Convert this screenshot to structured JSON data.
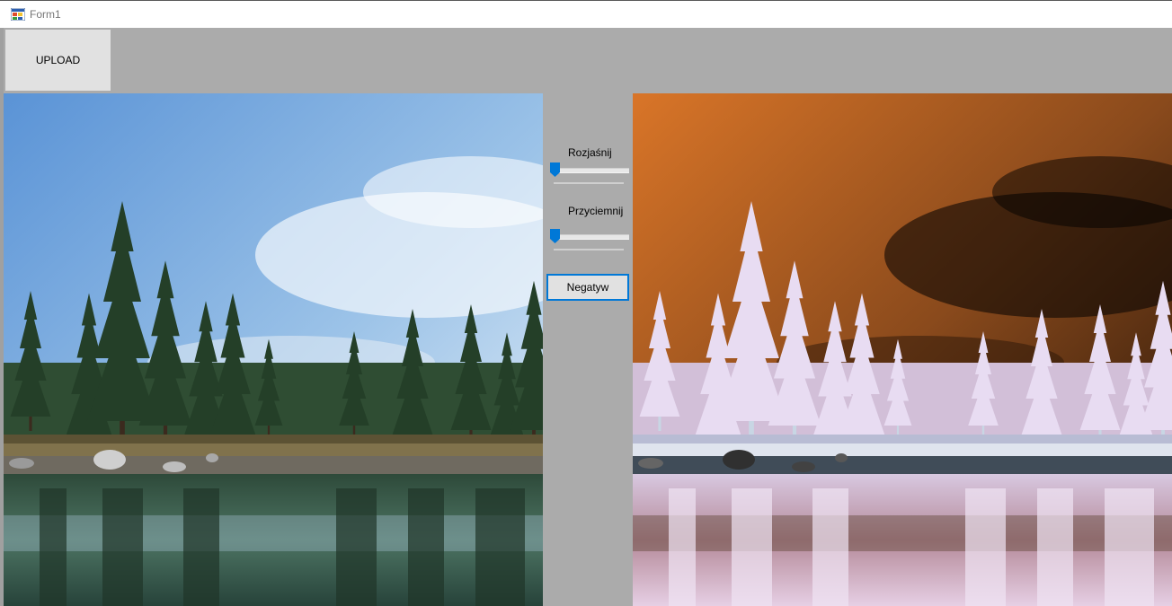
{
  "window": {
    "title": "Form1"
  },
  "toolbar": {
    "upload_label": "UPLOAD"
  },
  "controls": {
    "brighten": {
      "label": "Rozjaśnij",
      "value": 0
    },
    "darken": {
      "label": "Przyciemnij",
      "value": 0
    },
    "negative_label": "Negatyw"
  },
  "images": {
    "original": {
      "description_icon": "landscape-photo"
    },
    "processed": {
      "description_icon": "negative-photo"
    }
  },
  "colors": {
    "accent": "#0078d7",
    "form_background": "#ababab",
    "button_face": "#e1e1e1"
  }
}
